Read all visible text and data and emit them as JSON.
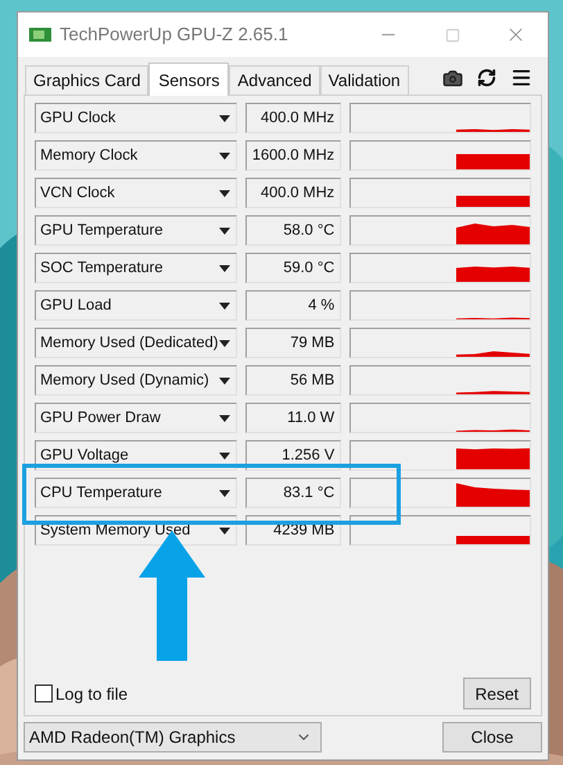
{
  "window": {
    "title": "TechPowerUp GPU-Z 2.65.1"
  },
  "tabs": [
    {
      "label": "Graphics Card",
      "selected": false
    },
    {
      "label": "Sensors",
      "selected": true
    },
    {
      "label": "Advanced",
      "selected": false
    },
    {
      "label": "Validation",
      "selected": false
    }
  ],
  "sensors": [
    {
      "name": "GPU Clock",
      "value": "400.0 MHz"
    },
    {
      "name": "Memory Clock",
      "value": "1600.0 MHz"
    },
    {
      "name": "VCN Clock",
      "value": "400.0 MHz"
    },
    {
      "name": "GPU Temperature",
      "value": "58.0 °C"
    },
    {
      "name": "SOC Temperature",
      "value": "59.0 °C"
    },
    {
      "name": "GPU Load",
      "value": "4 %"
    },
    {
      "name": "Memory Used (Dedicated)",
      "value": "79 MB"
    },
    {
      "name": "Memory Used (Dynamic)",
      "value": "56 MB"
    },
    {
      "name": "GPU Power Draw",
      "value": "11.0 W"
    },
    {
      "name": "GPU Voltage",
      "value": "1.256 V"
    },
    {
      "name": "CPU Temperature",
      "value": "83.1 °C"
    },
    {
      "name": "System Memory Used",
      "value": "4239 MB"
    }
  ],
  "log_to_file": {
    "label": "Log to file",
    "checked": false
  },
  "reset_button": "Reset",
  "device_select": {
    "value": "AMD Radeon(TM) Graphics"
  },
  "close_button": "Close"
}
